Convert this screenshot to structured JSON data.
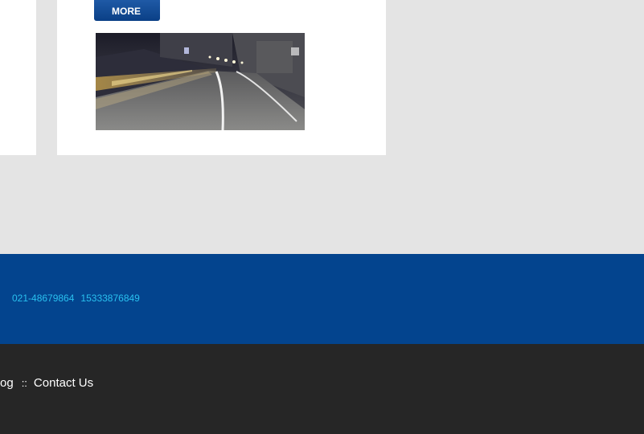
{
  "main_card": {
    "more_label": "MORE",
    "image_icon": "tunnel-road-photo"
  },
  "contact": {
    "phone_1": "021-48679864",
    "phone_2": "15333876849"
  },
  "footer": {
    "nav_items": [
      "og",
      "Contact Us"
    ],
    "separator": "::"
  },
  "colors": {
    "background": "#e4e4e4",
    "card": "#ffffff",
    "button": "#0a3f86",
    "contact_band": "#03448e",
    "phone_text": "#29c0ef",
    "footer": "#262626"
  }
}
